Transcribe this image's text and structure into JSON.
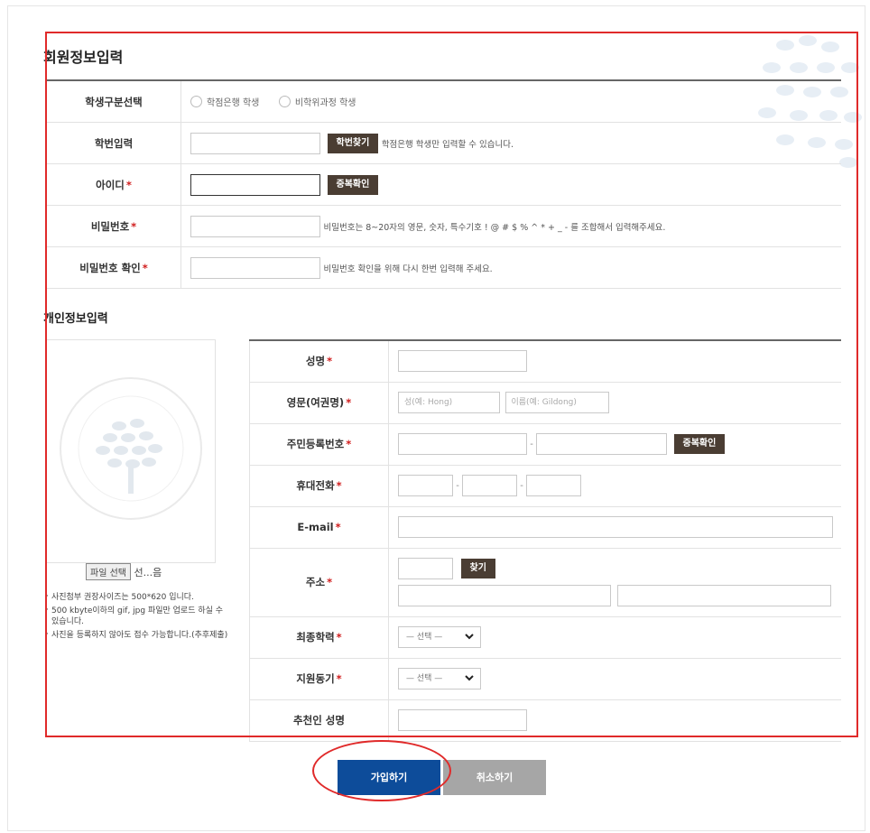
{
  "member_section": {
    "title": "회원정보입력",
    "student_type": {
      "label": "학생구분선택",
      "options": [
        "학점은행 학생",
        "비학위과정 학생"
      ]
    },
    "student_id": {
      "label": "학번입력",
      "button": "학번찾기",
      "hint": "학점은행 학생만 입력할 수 있습니다."
    },
    "user_id": {
      "label": "아이디",
      "required": "*",
      "button": "중복확인"
    },
    "password": {
      "label": "비밀번호",
      "required": "*",
      "hint": "비밀번호는 8~20자의 영문, 숫자, 특수기호 ! @ # $ % ^ * + _ - 를 조합해서 입력해주세요."
    },
    "password_confirm": {
      "label": "비밀번호 확인",
      "required": "*",
      "hint": "비밀번호 확인을 위해 다시 한번 입력해 주세요."
    }
  },
  "personal_section": {
    "title": "개인정보입력",
    "photo": {
      "file_button": "파일 선택",
      "file_status": "선...음",
      "notes": [
        "사진첨부 권장사이즈는 500*620 입니다.",
        "500 kbyte이하의 gif, jpg 파일만 업로드 하실 수 있습니다.",
        "사진을 등록하지 않아도 접수 가능합니다.(추후제출)"
      ]
    },
    "name": {
      "label": "성명",
      "required": "*"
    },
    "english_name": {
      "label": "영문(여권명)",
      "required": "*",
      "last_placeholder": "성(예: Hong)",
      "first_placeholder": "이름(예: Gildong)"
    },
    "resident_number": {
      "label": "주민등록번호",
      "required": "*",
      "separator": "-",
      "button": "중복확인"
    },
    "mobile": {
      "label": "휴대전화",
      "required": "*",
      "separator": "-"
    },
    "email": {
      "label": "E-mail",
      "required": "*"
    },
    "address": {
      "label": "주소",
      "required": "*",
      "button": "찾기"
    },
    "education": {
      "label": "최종학력",
      "required": "*",
      "selected": "— 선택 —"
    },
    "motivation": {
      "label": "지원동기",
      "required": "*",
      "selected": "— 선택 —"
    },
    "recommender": {
      "label": "추천인 성명"
    }
  },
  "actions": {
    "submit": "가입하기",
    "cancel": "취소하기"
  },
  "colors": {
    "annotation_red": "#e02a2a",
    "primary_blue": "#0d4c9a",
    "brown_button": "#4a3d33",
    "cancel_gray": "#a6a6a6"
  }
}
